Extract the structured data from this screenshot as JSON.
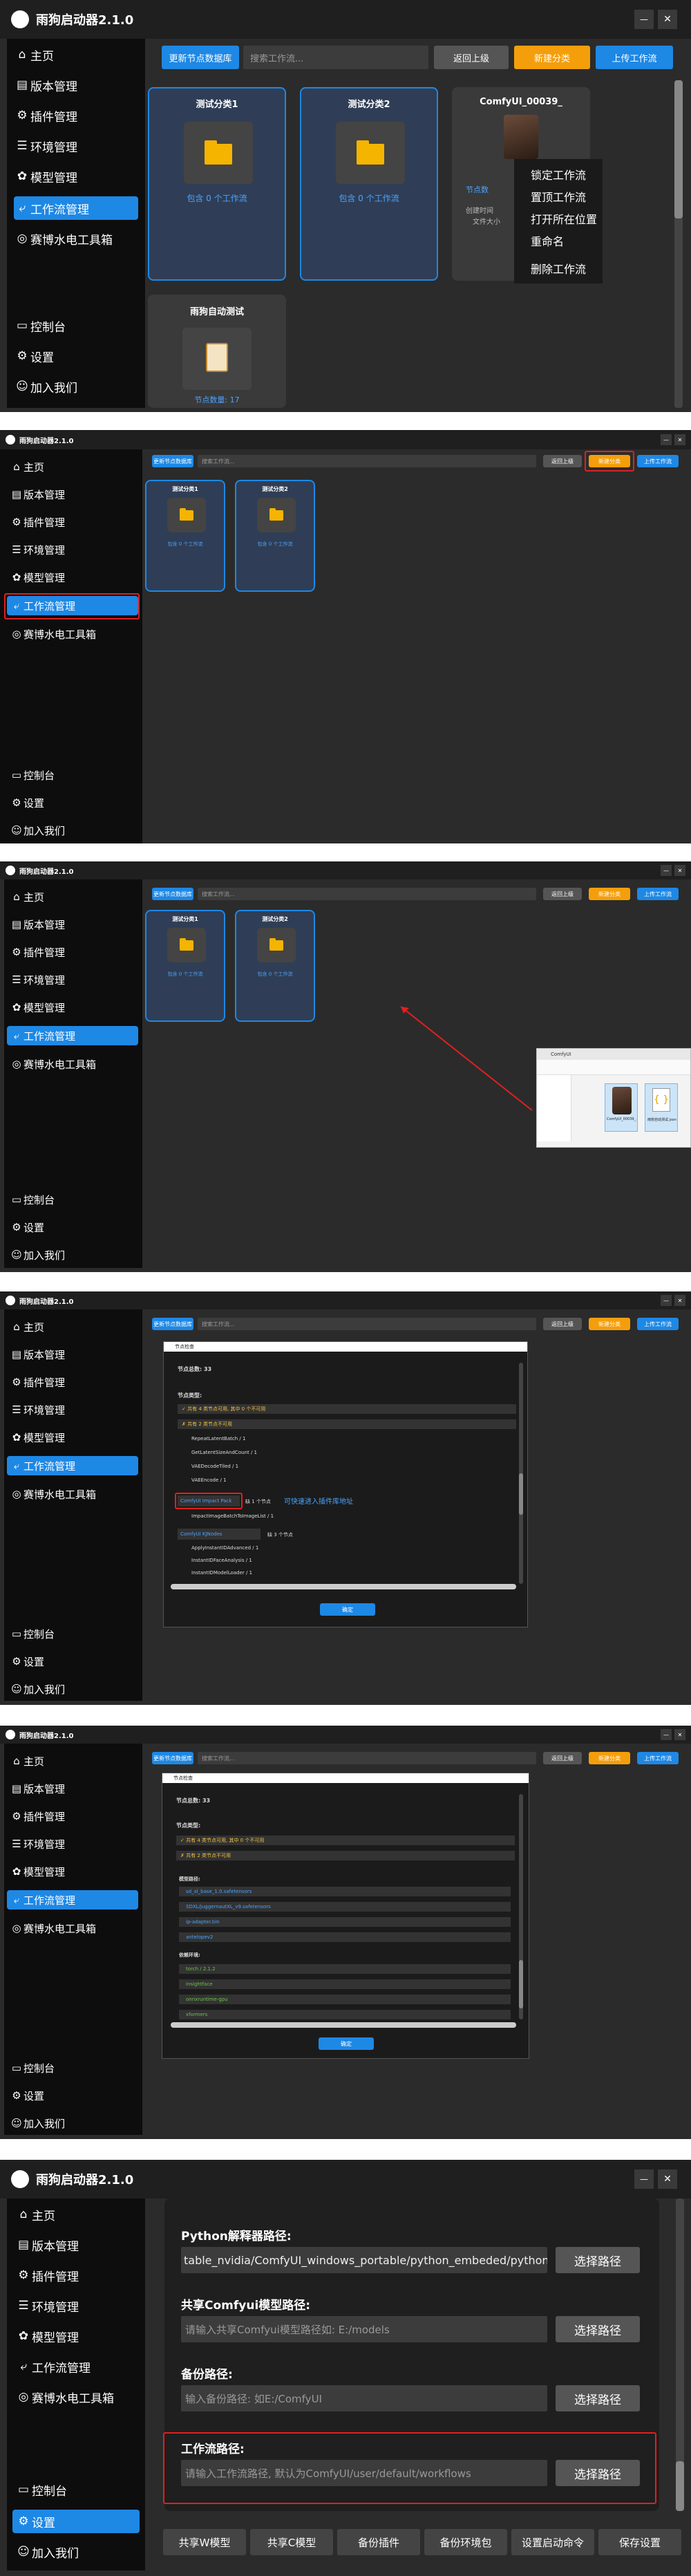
{
  "app": {
    "title": "雨狗启动器2.1.0",
    "minimize": "—",
    "close": "✕"
  },
  "nav": [
    {
      "icon": "⌂",
      "icon_name": "home-icon",
      "label": "主页"
    },
    {
      "icon": "▤",
      "icon_name": "version-icon",
      "label": "版本管理"
    },
    {
      "icon": "⚙",
      "icon_name": "plugin-icon",
      "label": "插件管理"
    },
    {
      "icon": "☰",
      "icon_name": "environment-icon",
      "label": "环境管理"
    },
    {
      "icon": "✿",
      "icon_name": "model-icon",
      "label": "模型管理"
    },
    {
      "icon": "⤶",
      "icon_name": "workflow-icon",
      "label": "工作流管理"
    },
    {
      "icon": "◎",
      "icon_name": "bsz-tools-icon",
      "label": "赛博水电工具箱"
    }
  ],
  "nav_bottom": [
    {
      "icon": "▭",
      "icon_name": "console-icon",
      "label": "控制台"
    },
    {
      "icon": "⚙",
      "icon_name": "settings-icon",
      "label": "设置"
    },
    {
      "icon": "☺",
      "icon_name": "join-us-icon",
      "label": "加入我们"
    }
  ],
  "workflow_toolbar": {
    "update_nodes": "更新节点数据库",
    "search_placeholder": "搜索工作流...",
    "back": "返回上级",
    "new_category": "新建分类",
    "upload": "上传工作流"
  },
  "workflow_cards": [
    {
      "name": "测试分类1",
      "sub": "包含 0 个工作流"
    },
    {
      "name": "测试分类2",
      "sub": "包含 0 个工作流"
    },
    {
      "name": "ComfyUI_00039_",
      "sub": "节点数"
    }
  ],
  "workflow_card_partial": {
    "name": "雨狗自动测试",
    "sub": "节点数量: 17",
    "meta": "创建时间",
    "meta2": "文件大小"
  },
  "context_menu": [
    "锁定工作流",
    "置顶工作流",
    "打开所在位置",
    "重命名",
    "删除工作流"
  ],
  "explorer": {
    "title": "ComfyUI",
    "file1": "ComfyUI_00039_.png",
    "file2": "雨狗自动测试.json"
  },
  "dialog1": {
    "title": "节点检查",
    "total": "节点总数: 33",
    "section": "节点类型:",
    "rows": [
      "✓ 共有 4 类节点可用, 其中 0 个不可用",
      "✗ 共有 2 类节点不可用",
      "RepeatLatentBatch / 1",
      "GetLatentSizeAndCount / 1",
      "VAEDecodeTiled / 1",
      "VAEEncode / 1"
    ],
    "pack": "ComfyUI Impact Pack",
    "pack_suffix": "缺 1 个节点",
    "pack_hint": "可快速进入插件库地址",
    "pack_row": "ImpactImageBatchToImageList / 1",
    "pack2": "ComfyUI KJNodes",
    "pack2_suffix": "缺 3 个节点",
    "pack2_rows": [
      "ApplyInstantIDAdvanced / 1",
      "InstantIDFaceAnalysis / 1",
      "InstantIDModelLoader / 1"
    ],
    "ok": "确定"
  },
  "dialog2": {
    "title": "节点检查",
    "total": "节点总数: 33",
    "section": "节点类型:",
    "rows": [
      "✓ 共有 4 类节点可用, 其中 0 个不可用",
      "✗ 共有 2 类节点不可用"
    ],
    "model_head": "模型路径:",
    "model_rows": [
      "sd_xl_base_1.0.safetensors",
      "SDXL/juggernautXL_v9.safetensors",
      "ip-adapter.bin",
      "antelopev2"
    ],
    "env_head": "依赖环境:",
    "env_rows": [
      "torch / 2.1.2",
      "insightface",
      "onnxruntime-gpu",
      "xformers"
    ],
    "ok": "确定"
  },
  "settings": {
    "python_label": "Python解释器路径:",
    "python_value": "table_nvidia/ComfyUI_windows_portable/python_embeded/python.exe",
    "shared_label": "共享Comfyui模型路径:",
    "shared_placeholder": "请输入共享Comfyui模型路径如: E:/models",
    "backup_label": "备份路径:",
    "backup_placeholder": "输入备份路径: 如E:/ComfyUI",
    "workflow_label": "工作流路径:",
    "workflow_placeholder": "请输入工作流路径, 默认为ComfyUI/user/default/workflows",
    "select": "选择路径",
    "bottom_buttons": [
      "共享W模型",
      "共享C模型",
      "备份插件",
      "备份环境包",
      "设置启动命令",
      "保存设置"
    ]
  },
  "colors": {
    "accent": "#1e88e5",
    "orange": "#f59e0b",
    "red": "#e02020",
    "bg": "#2b2b2b",
    "sidebar": "#0d0d0d"
  }
}
